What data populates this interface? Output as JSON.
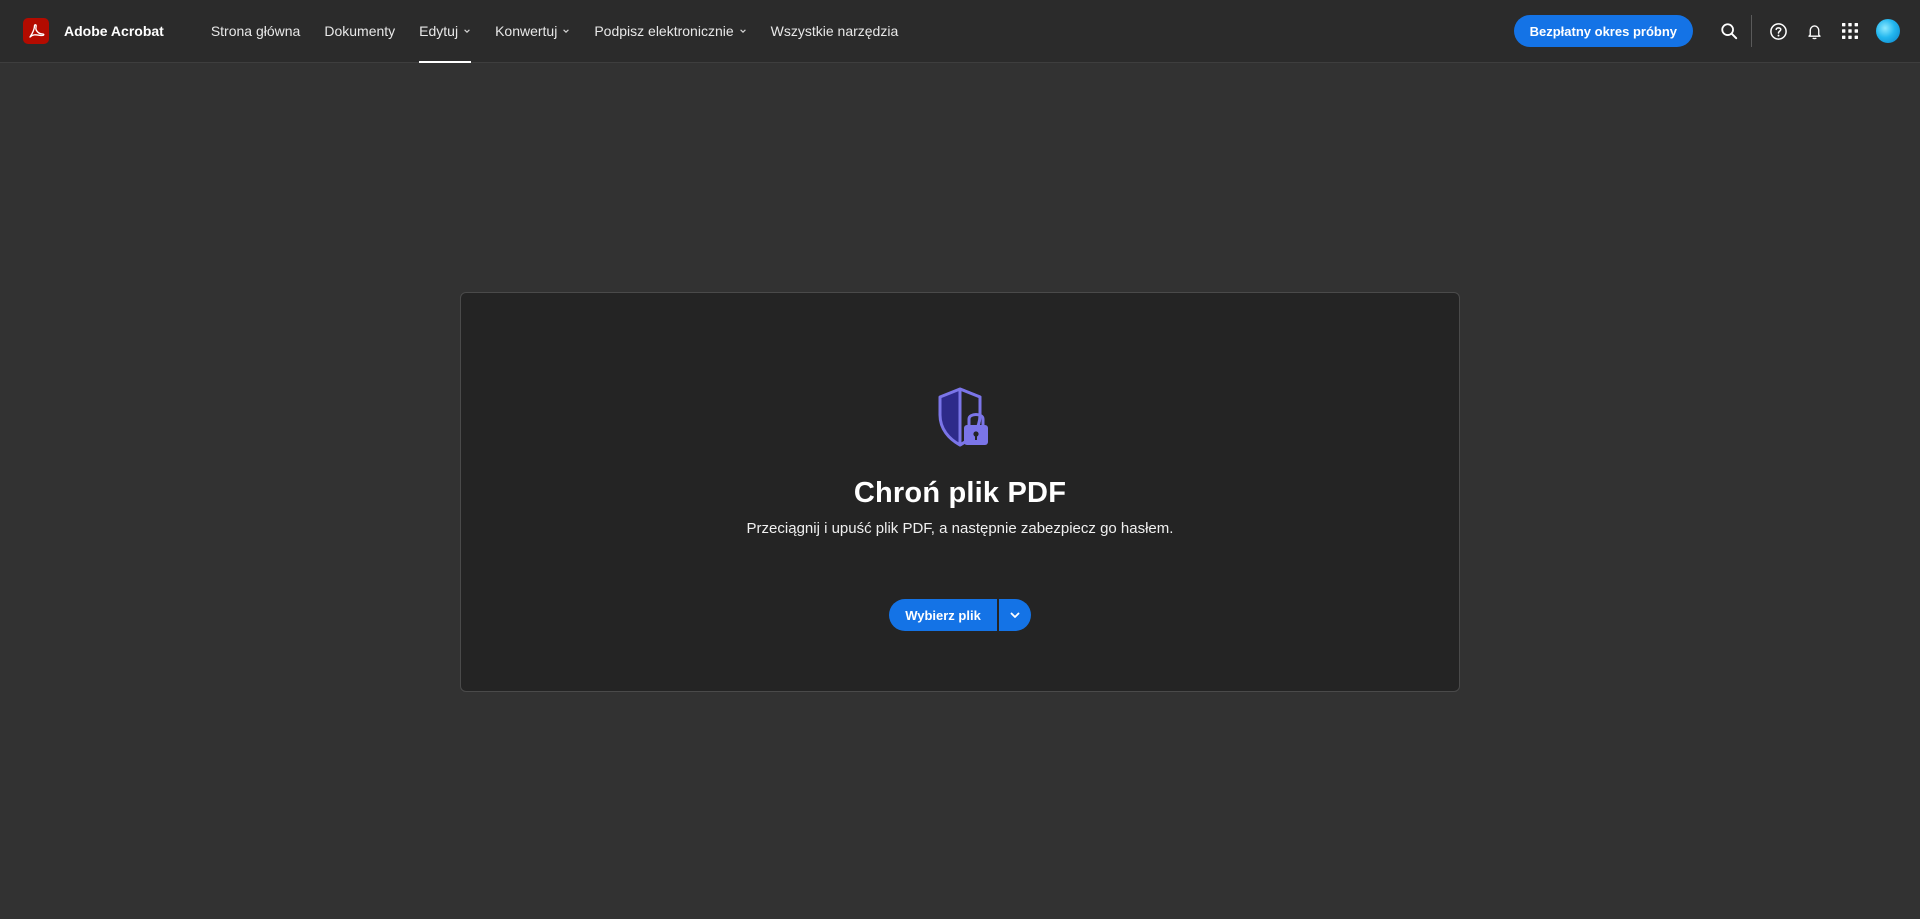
{
  "app": {
    "name": "Adobe Acrobat"
  },
  "nav": {
    "items": [
      {
        "label": "Strona główna",
        "dropdown": false,
        "active": false
      },
      {
        "label": "Dokumenty",
        "dropdown": false,
        "active": false
      },
      {
        "label": "Edytuj",
        "dropdown": true,
        "active": true
      },
      {
        "label": "Konwertuj",
        "dropdown": true,
        "active": false
      },
      {
        "label": "Podpisz elektronicznie",
        "dropdown": true,
        "active": false
      },
      {
        "label": "Wszystkie narzędzia",
        "dropdown": false,
        "active": false
      }
    ]
  },
  "header": {
    "trial_label": "Bezpłatny okres próbny",
    "icons": [
      "search-icon",
      "help-icon",
      "bell-icon",
      "apps-grid-icon",
      "avatar"
    ]
  },
  "main": {
    "title": "Chroń plik PDF",
    "subtitle": "Przeciągnij i upuść plik PDF, a następnie zabezpiecz go hasłem.",
    "choose_file_label": "Wybierz plik",
    "icon": "shield-lock-icon"
  },
  "colors": {
    "accent": "#1473e6",
    "brand_red": "#b30b00",
    "topbar_bg": "#2b2b2b",
    "page_bg": "#323232",
    "card_bg": "#242424",
    "shield_purple": "#7b75e8"
  }
}
